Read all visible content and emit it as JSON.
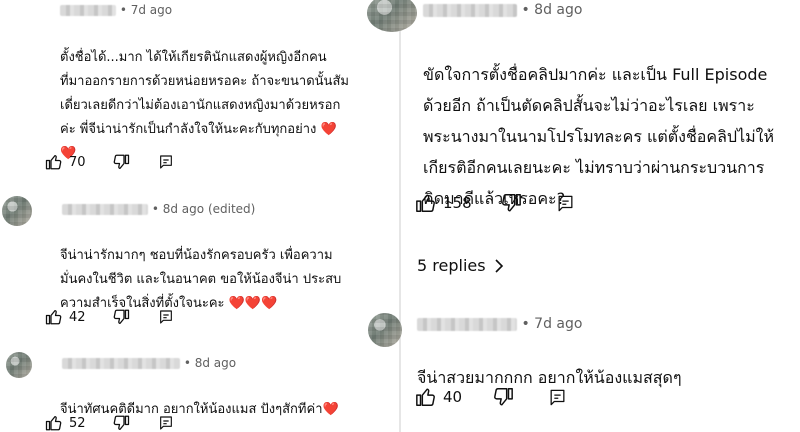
{
  "left": {
    "comments": [
      {
        "time": "7d ago",
        "edited": "",
        "lines": [
          "ตั้งชื่อได้...มาก ได้ให้เกียรตินักแสดงผู้หญิงอีกคน",
          "ที่มาออกรายการด้วยหน่อยหรอคะ ถ้าจะขนาดนั้นสัม",
          "เดี่ยวเลยดีกว่าไม่ต้องเอานักแสดงหญิงมาด้วยหรอก",
          "ค่ะ พี่จีน่าน่ารักเป็นกำลังใจให้นะคะกับทุกอย่าง ❤️",
          "❤️"
        ],
        "likes": "70"
      },
      {
        "time": "8d ago",
        "edited": "(edited)",
        "lines": [
          "จีน่าน่ารักมากๆ ชอบที่น้องรักครอบครัว เพื่อความ",
          "มั่นคงในชีวิต และในอนาคต ขอให้น้องจีน่า ประสบ",
          "ความสำเร็จในสิ่งที่ตั้งใจนะคะ ❤️❤️❤️"
        ],
        "likes": "42"
      },
      {
        "time": "8d ago",
        "edited": "",
        "lines": [
          "จีน่าทัศนคติดีมาก อยากให้น้องแมส ปังๆสักทีค่า❤️"
        ],
        "likes": "52"
      }
    ]
  },
  "right": {
    "comments": [
      {
        "time": "8d ago",
        "edited": "",
        "lines": [
          "ขัดใจการตั้งชื่อคลิปมากค่ะ และเป็น Full Episode",
          "ด้วยอีก ถ้าเป็นตัดคลิปสั้นจะไม่ว่าอะไรเลย เพราะ",
          "พระนางมาในนามโปรโมทละคร แต่ตั้งชื่อคลิปไม่ให้",
          "เกียรติอีกคนเลยนะคะ ไม่ทราบว่าผ่านกระบวนการ",
          "คิดมาดีแล้วเหรอคะ?"
        ],
        "likes": "158",
        "replies": "5 replies"
      },
      {
        "time": "7d ago",
        "edited": "",
        "lines": [
          "จีน่าสวยมากกกก อยากให้น้องแมสสุดๆ"
        ],
        "likes": "40"
      }
    ]
  },
  "icons": {
    "like": "thumbs-up-icon",
    "dislike": "thumbs-down-icon",
    "reply": "reply-comment-icon",
    "replies_chevron": "chevron-right-icon"
  },
  "colors": {
    "text": "#0f0f0f",
    "meta": "#606060",
    "heart": "#d62828"
  }
}
